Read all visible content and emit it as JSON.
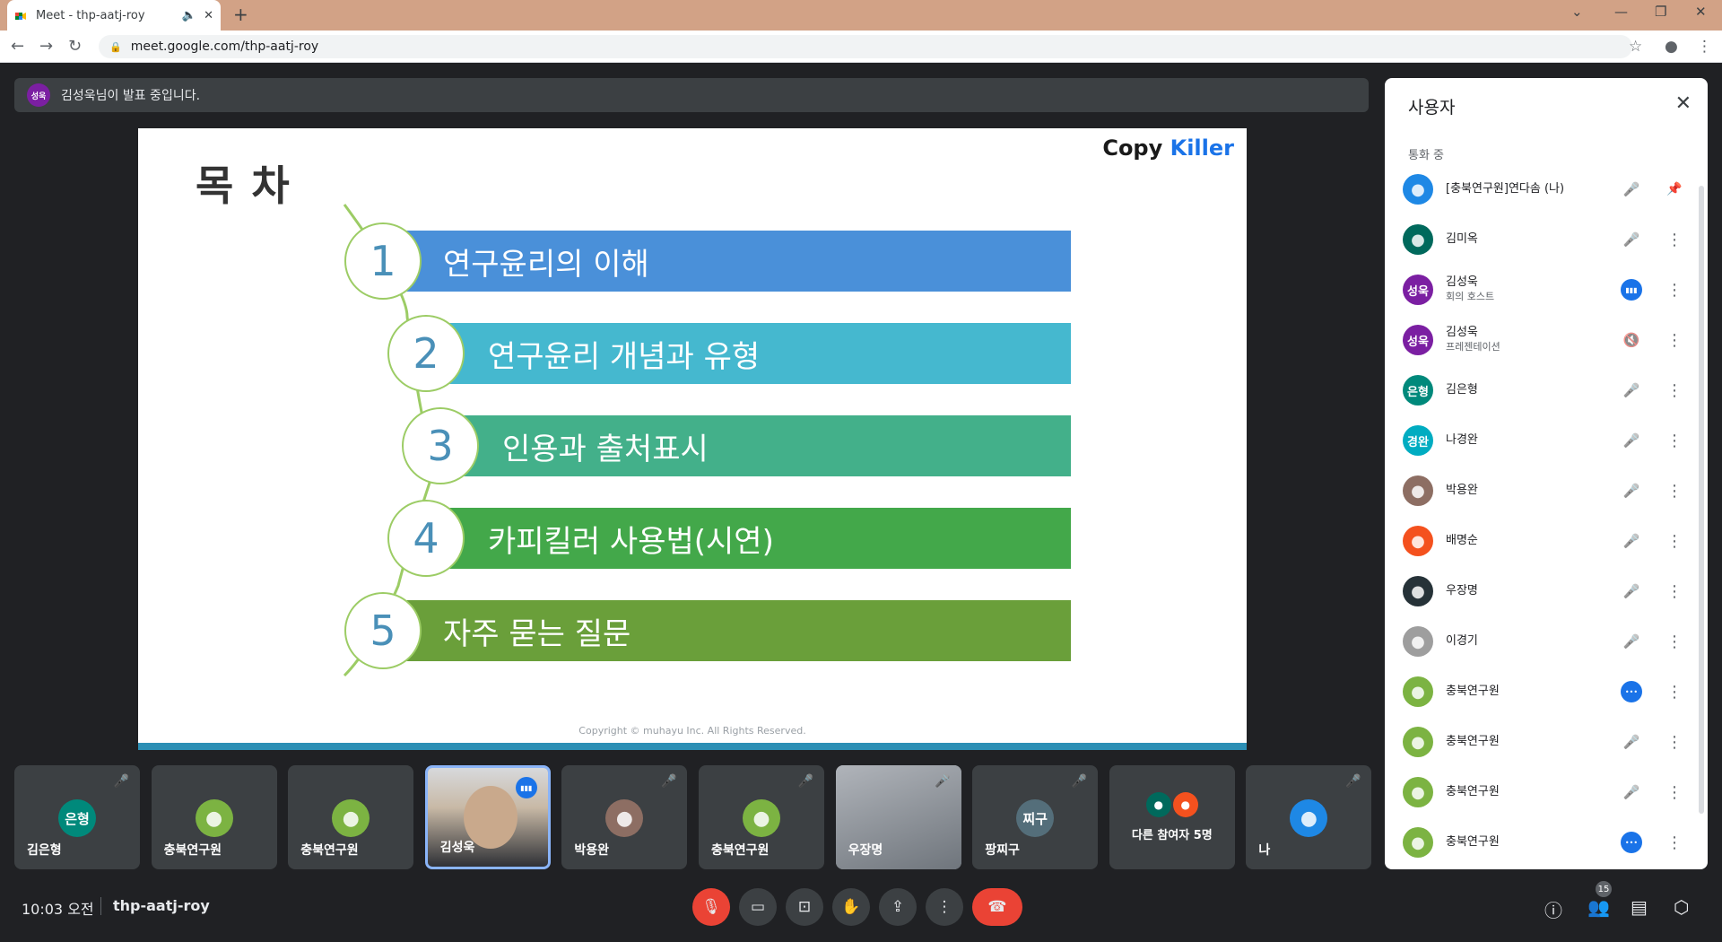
{
  "browser": {
    "tab_title": "Meet - thp-aatj-roy",
    "tab_audio_icon": "speaker-icon",
    "tab_close": "✕",
    "new_tab": "+",
    "url": "meet.google.com/thp-aatj-roy"
  },
  "banner": {
    "avatar_text": "성욱",
    "avatar_color": "#7b1fa2",
    "text": "김성욱님이 발표 중입니다."
  },
  "slide": {
    "heading": "목 차",
    "logo_part1": "Copy ",
    "logo_part2": "Killer",
    "items": [
      {
        "num": "1",
        "label": "연구윤리의 이해",
        "color": "#4a90d9"
      },
      {
        "num": "2",
        "label": "연구윤리 개념과 유형",
        "color": "#45b8cf"
      },
      {
        "num": "3",
        "label": "인용과 출처표시",
        "color": "#43b08a"
      },
      {
        "num": "4",
        "label": "카피킬러 사용법(시연)",
        "color": "#43a84a"
      },
      {
        "num": "5",
        "label": "자주 묻는 질문",
        "color": "#6a9f3a"
      }
    ],
    "copyright": "Copyright © muhayu Inc. All Rights Reserved."
  },
  "panel": {
    "title": "사용자",
    "section": "통화 중",
    "people": [
      {
        "name": "[충북연구원]연다솜 (나)",
        "sub": "",
        "avatar": "",
        "color": "#1e88e5",
        "status": "mic-off",
        "action": "pin"
      },
      {
        "name": "김미옥",
        "sub": "",
        "avatar": "",
        "color": "#00695c",
        "status": "mic-off",
        "action": "more"
      },
      {
        "name": "김성욱",
        "sub": "회의 호스트",
        "avatar": "성욱",
        "color": "#7b1fa2",
        "status": "speaking",
        "action": "more"
      },
      {
        "name": "김성욱",
        "sub": "프레젠테이션",
        "avatar": "성욱",
        "color": "#7b1fa2",
        "status": "audio-off",
        "action": "more"
      },
      {
        "name": "김은형",
        "sub": "",
        "avatar": "은형",
        "color": "#00897b",
        "status": "mic-off",
        "action": "more"
      },
      {
        "name": "나경완",
        "sub": "",
        "avatar": "경완",
        "color": "#00acc1",
        "status": "mic-off",
        "action": "more"
      },
      {
        "name": "박용완",
        "sub": "",
        "avatar": "",
        "color": "#8d6e63",
        "status": "mic-off",
        "action": "more"
      },
      {
        "name": "배명순",
        "sub": "",
        "avatar": "",
        "color": "#f4511e",
        "status": "mic-off",
        "action": "more"
      },
      {
        "name": "우장명",
        "sub": "",
        "avatar": "",
        "color": "#263238",
        "status": "mic-off",
        "action": "more"
      },
      {
        "name": "이경기",
        "sub": "",
        "avatar": "",
        "color": "#9e9e9e",
        "status": "mic-off",
        "action": "more"
      },
      {
        "name": "충북연구원",
        "sub": "",
        "avatar": "",
        "color": "#7cb342",
        "status": "talking-dots",
        "action": "more"
      },
      {
        "name": "충북연구원",
        "sub": "",
        "avatar": "",
        "color": "#7cb342",
        "status": "mic-off",
        "action": "more"
      },
      {
        "name": "충북연구원",
        "sub": "",
        "avatar": "",
        "color": "#7cb342",
        "status": "mic-off",
        "action": "more"
      },
      {
        "name": "충북연구원",
        "sub": "",
        "avatar": "",
        "color": "#7cb342",
        "status": "talking-dots",
        "action": "more"
      }
    ]
  },
  "tiles": [
    {
      "name": "김은형",
      "avatar": "은형",
      "color": "#00897b",
      "muted": true,
      "bg": "#3c4043"
    },
    {
      "name": "충북연구원",
      "avatar": "",
      "color": "#7cb342",
      "muted": false,
      "bg": "#3c4043"
    },
    {
      "name": "충북연구원",
      "avatar": "",
      "color": "#7cb342",
      "muted": false,
      "bg": "#3c4043"
    },
    {
      "name": "김성욱",
      "avatar": "",
      "color": "#7b1fa2",
      "muted": false,
      "bg": "#8a8f96",
      "video": true,
      "speaking": true
    },
    {
      "name": "박용완",
      "avatar": "",
      "color": "#8d6e63",
      "muted": true,
      "bg": "#3c4043"
    },
    {
      "name": "충북연구원",
      "avatar": "",
      "color": "#7cb342",
      "muted": true,
      "bg": "#3c4043"
    },
    {
      "name": "우장명",
      "avatar": "",
      "color": "#9aa0a6",
      "muted": true,
      "bg": "#8d939b",
      "video": true
    },
    {
      "name": "팡찌구",
      "avatar": "찌구",
      "color": "#546e7a",
      "muted": true,
      "bg": "#3c4043"
    },
    {
      "name": "다른 참여자 5명",
      "avatar": "",
      "color": "#00695c",
      "muted": false,
      "bg": "#3c4043",
      "others": true
    },
    {
      "name": "나",
      "avatar": "",
      "color": "#1e88e5",
      "muted": true,
      "bg": "#3c4043"
    }
  ],
  "controls": {
    "time": "10:03 오전",
    "meeting_code": "thp-aatj-roy",
    "participant_count": "15",
    "mic_color": "#ea4335",
    "leave_color": "#ea4335"
  }
}
